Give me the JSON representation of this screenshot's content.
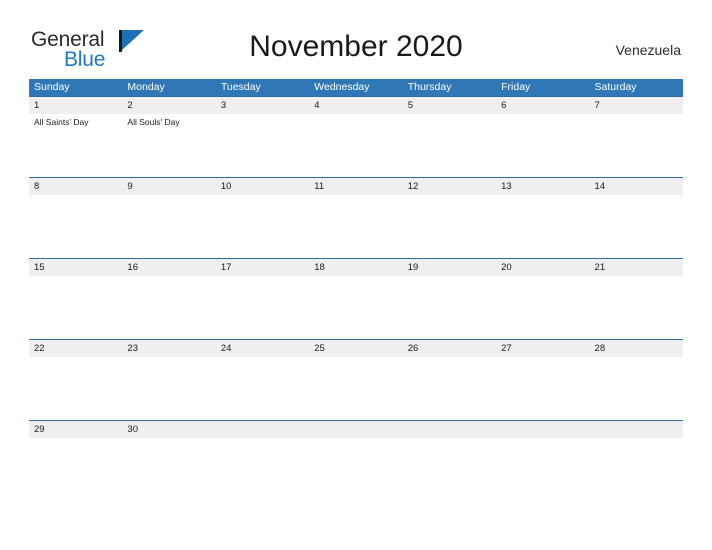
{
  "brand": {
    "word1": "General",
    "word2": "Blue",
    "flag_icon": "flag-triangle-icon",
    "color_primary": "#1f7ac4",
    "color_flag": "#1f6fb5"
  },
  "header": {
    "title": "November 2020",
    "region": "Venezuela"
  },
  "theme": {
    "header_blue": "#3077b5",
    "row_border_blue": "#2e6da4",
    "date_band_gray": "#efefef",
    "text_dark": "#1a1a1a",
    "page_background": "#ffffff"
  },
  "calendar": {
    "month": "November",
    "year": "2020",
    "weekday_headers": [
      "Sunday",
      "Monday",
      "Tuesday",
      "Wednesday",
      "Thursday",
      "Friday",
      "Saturday"
    ],
    "weeks": [
      [
        {
          "day": "1",
          "event": "All Saints' Day"
        },
        {
          "day": "2",
          "event": "All Souls' Day"
        },
        {
          "day": "3",
          "event": ""
        },
        {
          "day": "4",
          "event": ""
        },
        {
          "day": "5",
          "event": ""
        },
        {
          "day": "6",
          "event": ""
        },
        {
          "day": "7",
          "event": ""
        }
      ],
      [
        {
          "day": "8",
          "event": ""
        },
        {
          "day": "9",
          "event": ""
        },
        {
          "day": "10",
          "event": ""
        },
        {
          "day": "11",
          "event": ""
        },
        {
          "day": "12",
          "event": ""
        },
        {
          "day": "13",
          "event": ""
        },
        {
          "day": "14",
          "event": ""
        }
      ],
      [
        {
          "day": "15",
          "event": ""
        },
        {
          "day": "16",
          "event": ""
        },
        {
          "day": "17",
          "event": ""
        },
        {
          "day": "18",
          "event": ""
        },
        {
          "day": "19",
          "event": ""
        },
        {
          "day": "20",
          "event": ""
        },
        {
          "day": "21",
          "event": ""
        }
      ],
      [
        {
          "day": "22",
          "event": ""
        },
        {
          "day": "23",
          "event": ""
        },
        {
          "day": "24",
          "event": ""
        },
        {
          "day": "25",
          "event": ""
        },
        {
          "day": "26",
          "event": ""
        },
        {
          "day": "27",
          "event": ""
        },
        {
          "day": "28",
          "event": ""
        }
      ],
      [
        {
          "day": "29",
          "event": ""
        },
        {
          "day": "30",
          "event": ""
        },
        {
          "day": "",
          "event": ""
        },
        {
          "day": "",
          "event": ""
        },
        {
          "day": "",
          "event": ""
        },
        {
          "day": "",
          "event": ""
        },
        {
          "day": "",
          "event": ""
        }
      ]
    ]
  }
}
